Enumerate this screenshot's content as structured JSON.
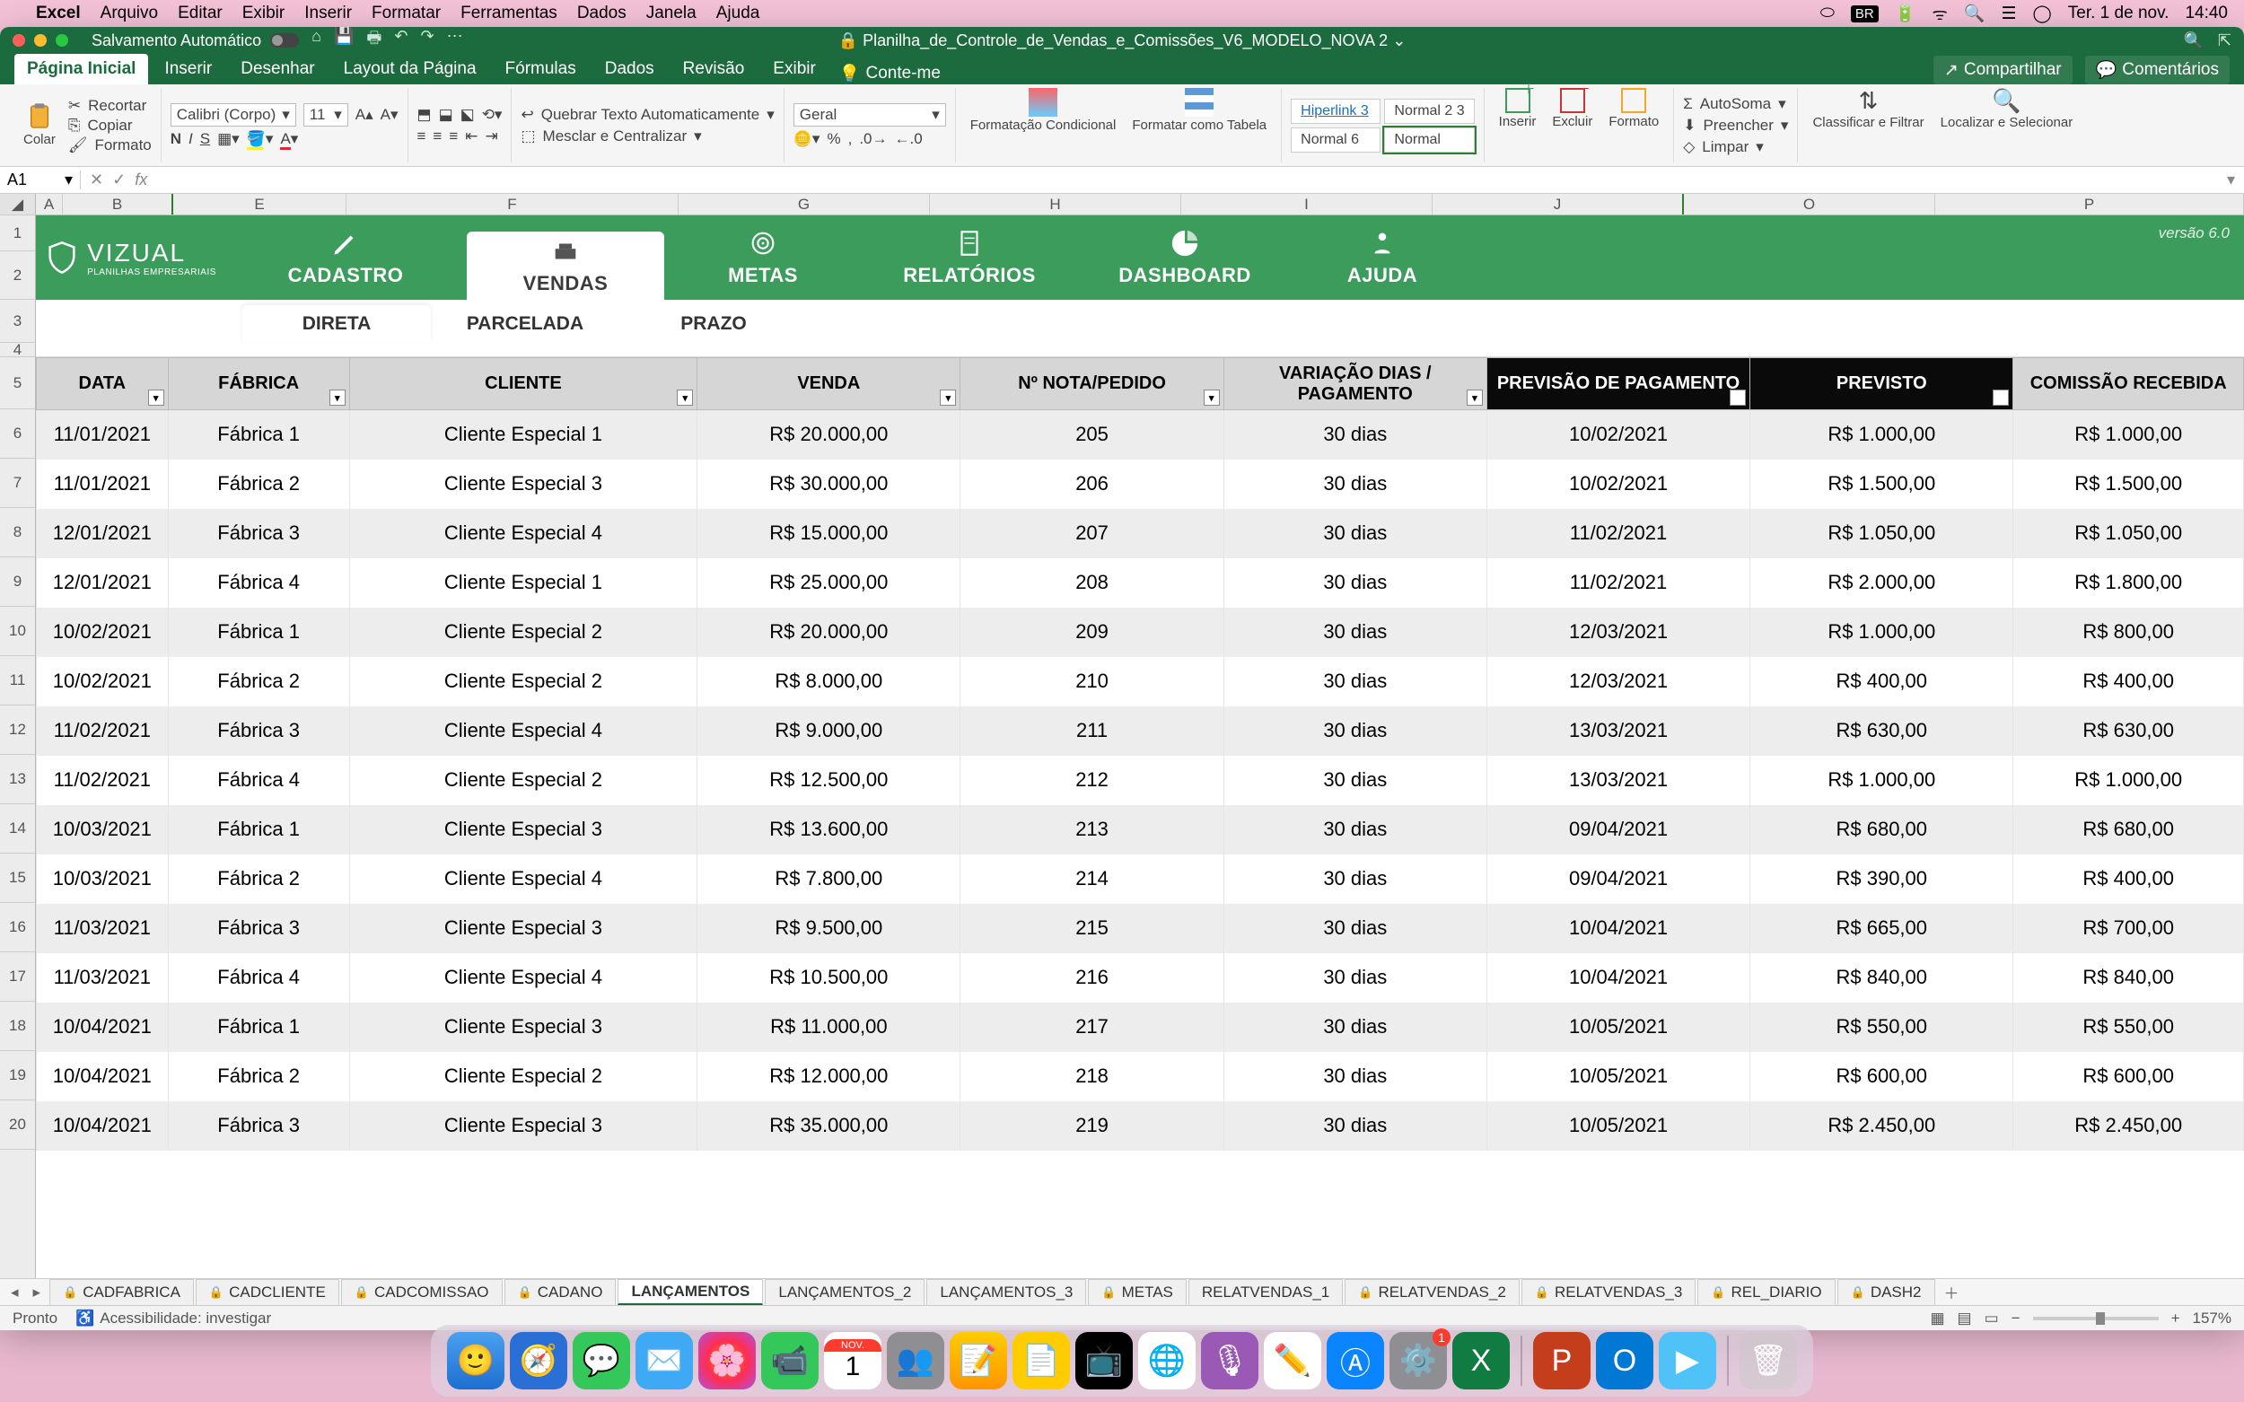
{
  "menubar": {
    "app": "Excel",
    "items": [
      "Arquivo",
      "Editar",
      "Exibir",
      "Inserir",
      "Formatar",
      "Ferramentas",
      "Dados",
      "Janela",
      "Ajuda"
    ],
    "right_date": "Ter. 1 de nov.",
    "right_time": "14:40",
    "input_lang": "BR"
  },
  "titlebar": {
    "autosave": "Salvamento Automático",
    "filename": "Planilha_de_Controle_de_Vendas_e_Comissões_V6_MODELO_NOVA 2"
  },
  "ribbon_tabs": {
    "tabs": [
      "Página Inicial",
      "Inserir",
      "Desenhar",
      "Layout da Página",
      "Fórmulas",
      "Dados",
      "Revisão",
      "Exibir"
    ],
    "tellme": "Conte-me",
    "share": "Compartilhar",
    "comments": "Comentários"
  },
  "ribbon": {
    "paste": "Colar",
    "cut": "Recortar",
    "copy": "Copiar",
    "format": "Formato",
    "font_name": "Calibri (Corpo)",
    "font_size": "11",
    "wrap": "Quebrar Texto Automaticamente",
    "merge": "Mesclar e Centralizar",
    "numfmt": "Geral",
    "cond": "Formatação Condicional",
    "astable": "Formatar como Tabela",
    "style1": "Hiperlink 3",
    "style2": "Normal 2 3",
    "style3": "Normal 6",
    "style4": "Normal",
    "insert": "Inserir",
    "delete": "Excluir",
    "formatc": "Formato",
    "autosum": "AutoSoma",
    "fill": "Preencher",
    "clear": "Limpar",
    "sort": "Classificar e Filtrar",
    "find": "Localizar e Selecionar"
  },
  "namebox": "A1",
  "colheads": [
    "A",
    "B",
    "E",
    "F",
    "G",
    "H",
    "I",
    "J",
    "O",
    "P"
  ],
  "rownums": [
    "1",
    "2",
    "3",
    "4",
    "5",
    "6",
    "7",
    "8",
    "9",
    "10",
    "11",
    "12",
    "13",
    "14",
    "15",
    "16",
    "17",
    "18",
    "19",
    "20"
  ],
  "nav": {
    "brand": "VIZUAL",
    "brand_sub": "PLANILHAS EMPRESARIAIS",
    "items": [
      "CADASTRO",
      "VENDAS",
      "METAS",
      "RELATÓRIOS",
      "DASHBOARD",
      "AJUDA"
    ],
    "version": "versão 6.0"
  },
  "subnav": [
    "DIRETA",
    "PARCELADA",
    "PRAZO"
  ],
  "headers": {
    "data": "DATA",
    "fabrica": "FÁBRICA",
    "cliente": "CLIENTE",
    "venda": "VENDA",
    "nota": "Nº NOTA/PEDIDO",
    "variacao": "VARIAÇÃO DIAS / PAGAMENTO",
    "previsao_pag": "PREVISÃO DE PAGAMENTO",
    "previsto": "PREVISTO",
    "comissao": "COMISSÃO RECEBIDA"
  },
  "rows": [
    {
      "data": "11/01/2021",
      "fab": "Fábrica 1",
      "cli": "Cliente Especial 1",
      "venda": "R$ 20.000,00",
      "nota": "205",
      "var": "30 dias",
      "prev": "10/02/2021",
      "previsto": "R$ 1.000,00",
      "com": "R$ 1.000,00"
    },
    {
      "data": "11/01/2021",
      "fab": "Fábrica 2",
      "cli": "Cliente Especial 3",
      "venda": "R$ 30.000,00",
      "nota": "206",
      "var": "30 dias",
      "prev": "10/02/2021",
      "previsto": "R$ 1.500,00",
      "com": "R$ 1.500,00"
    },
    {
      "data": "12/01/2021",
      "fab": "Fábrica 3",
      "cli": "Cliente Especial 4",
      "venda": "R$ 15.000,00",
      "nota": "207",
      "var": "30 dias",
      "prev": "11/02/2021",
      "previsto": "R$ 1.050,00",
      "com": "R$ 1.050,00"
    },
    {
      "data": "12/01/2021",
      "fab": "Fábrica 4",
      "cli": "Cliente Especial 1",
      "venda": "R$ 25.000,00",
      "nota": "208",
      "var": "30 dias",
      "prev": "11/02/2021",
      "previsto": "R$ 2.000,00",
      "com": "R$ 1.800,00"
    },
    {
      "data": "10/02/2021",
      "fab": "Fábrica 1",
      "cli": "Cliente Especial 2",
      "venda": "R$ 20.000,00",
      "nota": "209",
      "var": "30 dias",
      "prev": "12/03/2021",
      "previsto": "R$ 1.000,00",
      "com": "R$ 800,00"
    },
    {
      "data": "10/02/2021",
      "fab": "Fábrica 2",
      "cli": "Cliente Especial 2",
      "venda": "R$ 8.000,00",
      "nota": "210",
      "var": "30 dias",
      "prev": "12/03/2021",
      "previsto": "R$ 400,00",
      "com": "R$ 400,00"
    },
    {
      "data": "11/02/2021",
      "fab": "Fábrica 3",
      "cli": "Cliente Especial 4",
      "venda": "R$ 9.000,00",
      "nota": "211",
      "var": "30 dias",
      "prev": "13/03/2021",
      "previsto": "R$ 630,00",
      "com": "R$ 630,00"
    },
    {
      "data": "11/02/2021",
      "fab": "Fábrica 4",
      "cli": "Cliente Especial 2",
      "venda": "R$ 12.500,00",
      "nota": "212",
      "var": "30 dias",
      "prev": "13/03/2021",
      "previsto": "R$ 1.000,00",
      "com": "R$ 1.000,00"
    },
    {
      "data": "10/03/2021",
      "fab": "Fábrica 1",
      "cli": "Cliente Especial 3",
      "venda": "R$ 13.600,00",
      "nota": "213",
      "var": "30 dias",
      "prev": "09/04/2021",
      "previsto": "R$ 680,00",
      "com": "R$ 680,00"
    },
    {
      "data": "10/03/2021",
      "fab": "Fábrica 2",
      "cli": "Cliente Especial 4",
      "venda": "R$ 7.800,00",
      "nota": "214",
      "var": "30 dias",
      "prev": "09/04/2021",
      "previsto": "R$ 390,00",
      "com": "R$ 400,00"
    },
    {
      "data": "11/03/2021",
      "fab": "Fábrica 3",
      "cli": "Cliente Especial 3",
      "venda": "R$ 9.500,00",
      "nota": "215",
      "var": "30 dias",
      "prev": "10/04/2021",
      "previsto": "R$ 665,00",
      "com": "R$ 700,00"
    },
    {
      "data": "11/03/2021",
      "fab": "Fábrica 4",
      "cli": "Cliente Especial 4",
      "venda": "R$ 10.500,00",
      "nota": "216",
      "var": "30 dias",
      "prev": "10/04/2021",
      "previsto": "R$ 840,00",
      "com": "R$ 840,00"
    },
    {
      "data": "10/04/2021",
      "fab": "Fábrica 1",
      "cli": "Cliente Especial 3",
      "venda": "R$ 11.000,00",
      "nota": "217",
      "var": "30 dias",
      "prev": "10/05/2021",
      "previsto": "R$ 550,00",
      "com": "R$ 550,00"
    },
    {
      "data": "10/04/2021",
      "fab": "Fábrica 2",
      "cli": "Cliente Especial 2",
      "venda": "R$ 12.000,00",
      "nota": "218",
      "var": "30 dias",
      "prev": "10/05/2021",
      "previsto": "R$ 600,00",
      "com": "R$ 600,00"
    },
    {
      "data": "10/04/2021",
      "fab": "Fábrica 3",
      "cli": "Cliente Especial 3",
      "venda": "R$ 35.000,00",
      "nota": "219",
      "var": "30 dias",
      "prev": "10/05/2021",
      "previsto": "R$ 2.450,00",
      "com": "R$ 2.450,00"
    }
  ],
  "sheets": [
    "CADFABRICA",
    "CADCLIENTE",
    "CADCOMISSAO",
    "CADANO",
    "LANÇAMENTOS",
    "LANÇAMENTOS_2",
    "LANÇAMENTOS_3",
    "METAS",
    "RELATVENDAS_1",
    "RELATVENDAS_2",
    "RELATVENDAS_3",
    "REL_DIARIO",
    "DASH2"
  ],
  "sheets_locked": [
    true,
    true,
    true,
    true,
    false,
    false,
    false,
    true,
    false,
    true,
    true,
    true,
    true
  ],
  "active_sheet": 4,
  "status": {
    "ready": "Pronto",
    "acc": "Acessibilidade: investigar",
    "zoom": "157%"
  }
}
